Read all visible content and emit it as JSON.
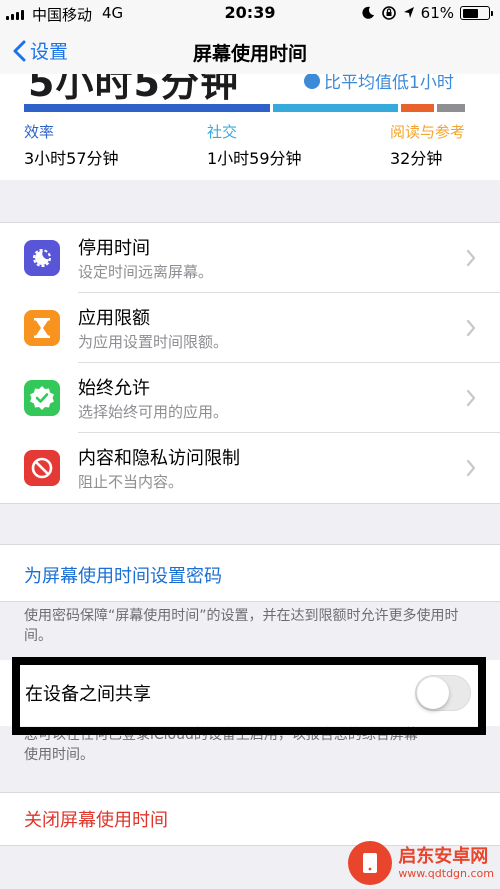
{
  "status_bar": {
    "carrier": "中国移动",
    "network": "4G",
    "time": "20:39",
    "battery": "61%",
    "battery_level": 0.61
  },
  "nav": {
    "back_label": "设置",
    "title": "屏幕使用时间"
  },
  "summary": {
    "cut_headline": "5小时5分钟",
    "cut_compare": "比平均值低1小时",
    "categories": [
      {
        "label": "效率",
        "value": "3小时57分钟",
        "color": "#2f62c9"
      },
      {
        "label": "社交",
        "value": "1小时59分钟",
        "color": "#37aadc"
      },
      {
        "label": "阅读与参考",
        "value": "32分钟",
        "color": "#f4a52a"
      }
    ],
    "usage_segments": [
      {
        "color": "#2f62c9",
        "fraction": 0.556
      },
      {
        "color": "#37aadc",
        "fraction": 0.282
      },
      {
        "color": "#e8632b",
        "fraction": 0.075
      },
      {
        "color": "#8e8e93",
        "fraction": 0.063
      }
    ]
  },
  "settings_items": [
    {
      "title": "停用时间",
      "subtitle": "设定时间远离屏幕。",
      "icon": "downtime-icon",
      "icon_color": "#5856d6"
    },
    {
      "title": "应用限额",
      "subtitle": "为应用设置时间限额。",
      "icon": "hourglass-icon",
      "icon_color": "#f7931e"
    },
    {
      "title": "始终允许",
      "subtitle": "选择始终可用的应用。",
      "icon": "checkmark-badge-icon",
      "icon_color": "#34c759"
    },
    {
      "title": "内容和隐私访问限制",
      "subtitle": "阻止不当内容。",
      "icon": "no-entry-icon",
      "icon_color": "#e53935"
    }
  ],
  "passcode": {
    "link": "为屏幕使用时间设置密码",
    "footnote": "使用密码保障“屏幕使用时间”的设置，并在达到限额时允许更多使用时间。"
  },
  "share": {
    "label": "在设备之间共享",
    "enabled": false,
    "footnote_line1": "您可以在任何已登录iCloud的设备上启用，以报告您的综合屏幕",
    "footnote_line2": "使用时间。"
  },
  "turn_off": {
    "label": "关闭屏幕使用时间"
  },
  "watermark": {
    "name": "启东安卓网",
    "url": "www.qdtdgn.com"
  }
}
